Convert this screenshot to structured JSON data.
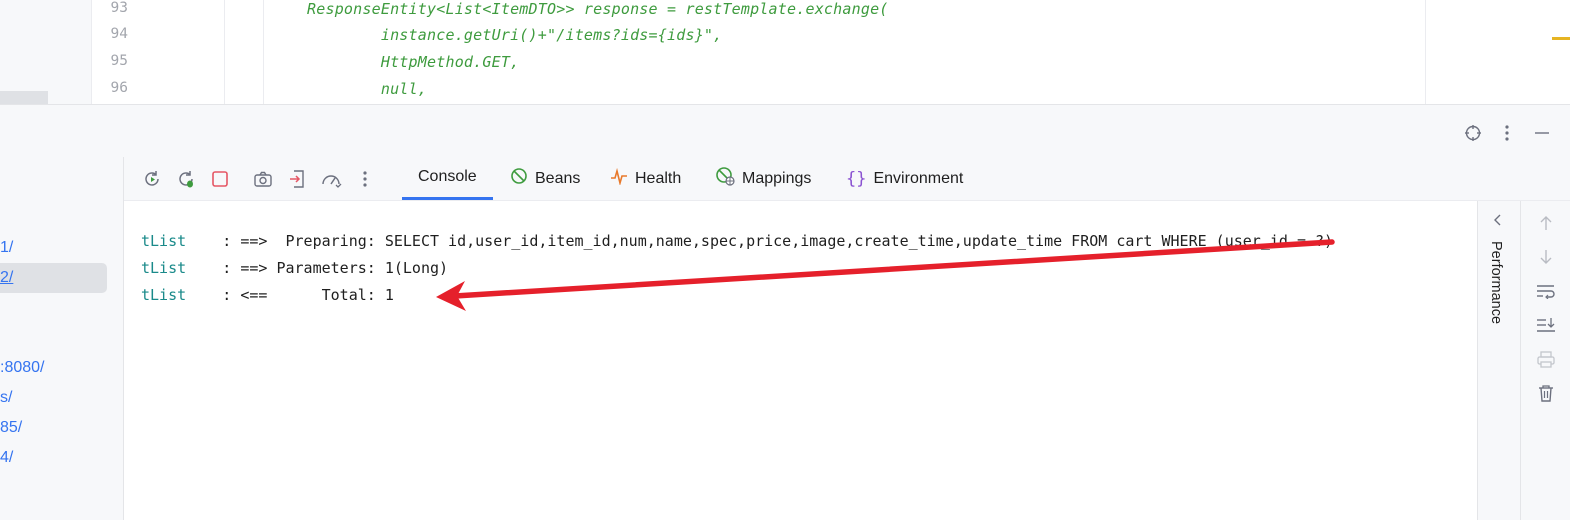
{
  "editor": {
    "line_numbers": [
      "93",
      "94",
      "95",
      "96"
    ],
    "code_lines": [
      "ResponseEntity<List<ItemDTO>> response = restTemplate.exchange(",
      "        instance.getUri()+\"/items?ids={ids}\",",
      "        HttpMethod.GET,",
      "        null,"
    ]
  },
  "services": {
    "items": [
      "1/",
      "2/",
      ":8080/",
      "s/",
      "85/",
      "4/"
    ]
  },
  "tabs": [
    {
      "label": "Console",
      "icon": "console"
    },
    {
      "label": "Beans",
      "icon": "beans-icon"
    },
    {
      "label": "Health",
      "icon": "health-icon"
    },
    {
      "label": "Mappings",
      "icon": "mappings-icon"
    },
    {
      "label": "Environment",
      "icon": "environment-icon"
    }
  ],
  "console": {
    "lines": [
      {
        "source": "tList",
        "text": "    : ==>  Preparing: SELECT id,user_id,item_id,num,name,spec,price,image,create_time,update_time FROM cart WHERE (user_id = ?)"
      },
      {
        "source": "tList",
        "text": "    : ==> Parameters: 1(Long)"
      },
      {
        "source": "tList",
        "text": "    : <==      Total: 1"
      }
    ]
  },
  "right_panel": {
    "performance_label": "Performance"
  },
  "colors": {
    "accent": "#3574f0",
    "code_green": "#3e9b3e",
    "log_source": "#1a8a8a",
    "annotation_arrow": "#e5202b",
    "stop_red": "#e55765"
  }
}
